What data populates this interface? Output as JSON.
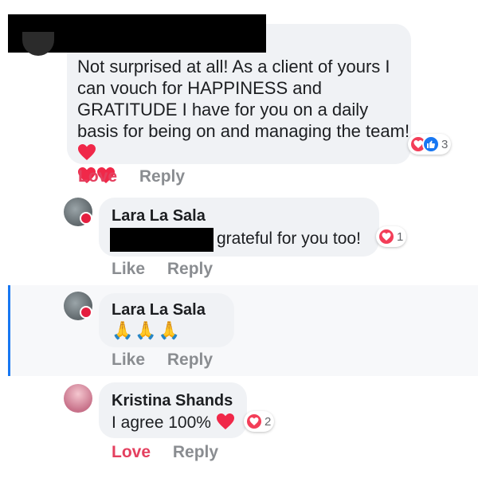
{
  "comment1": {
    "text": "Not surprised at all! As a client of yours I can vouch for HAPPINESS and GRATITUDE I have for you on a daily basis for being on and managing the team!",
    "reaction_count": "3",
    "action_love": "Love",
    "action_reply": "Reply"
  },
  "reply1": {
    "author": "Lara La Sala",
    "text": "grateful for you too!",
    "reaction_count": "1",
    "action_like": "Like",
    "action_reply": "Reply"
  },
  "reply2": {
    "author": "Lara La Sala",
    "emoji": "🙏🙏🙏",
    "action_like": "Like",
    "action_reply": "Reply"
  },
  "reply3": {
    "author": "Kristina Shands",
    "text": "I agree 100%",
    "reaction_count": "2",
    "action_love": "Love",
    "action_reply": "Reply"
  },
  "colors": {
    "love": "#e4405f",
    "like_blue": "#1877f2",
    "heart_red": "#f02849",
    "bubble": "#f0f2f5",
    "action_gray": "#8a8d91"
  },
  "icons": [
    "heart-icon",
    "love-reaction-icon",
    "like-reaction-icon",
    "avatar",
    "pray-emoji"
  ]
}
